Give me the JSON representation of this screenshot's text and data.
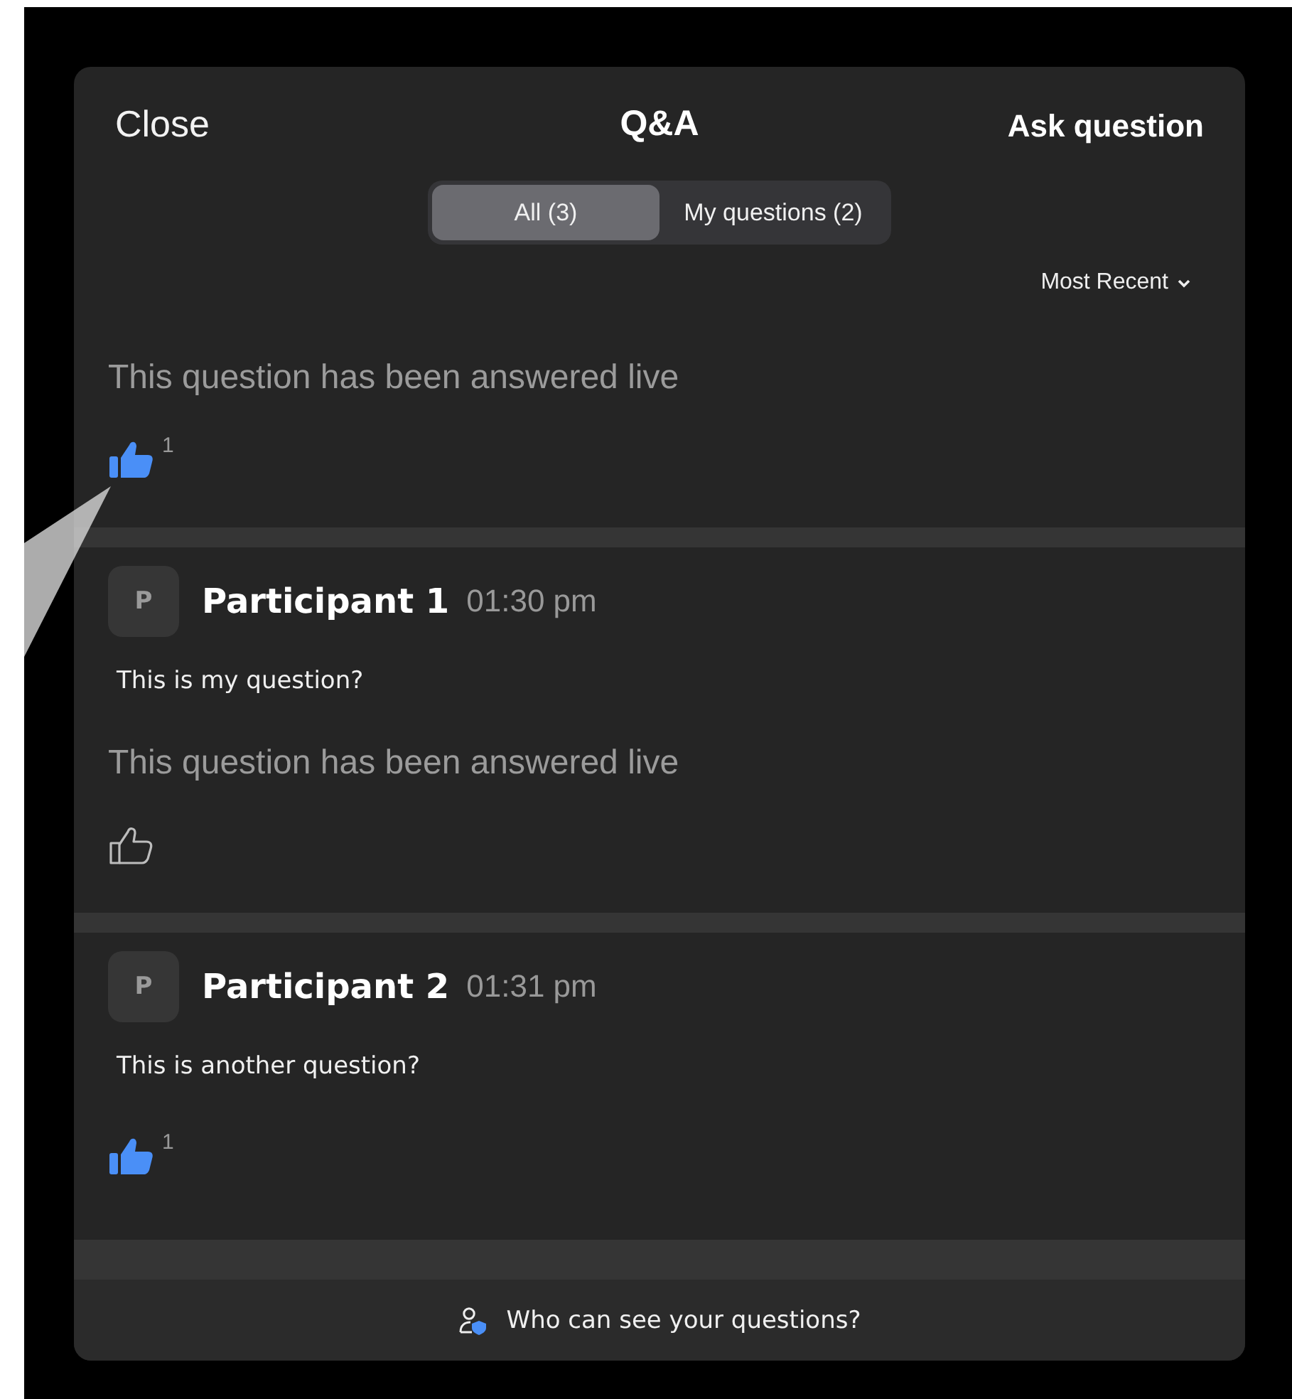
{
  "header": {
    "close": "Close",
    "title": "Q&A",
    "action": "Ask question"
  },
  "filters": [
    {
      "label": "All (3)",
      "selected": true
    },
    {
      "label": "My questions (2)",
      "selected": false
    }
  ],
  "sort": {
    "label": "Most Recent"
  },
  "questions": [
    {
      "answered_note": "This question has been answered live",
      "liked": true,
      "likes": "1"
    },
    {
      "avatar": "P",
      "author": "Participant 1",
      "time": "01:30 pm",
      "text": "This is my question?",
      "answered_note": "This question has been answered live",
      "liked": false
    },
    {
      "avatar": "P",
      "author": "Participant 2",
      "time": "01:31 pm",
      "text": "This is another question?",
      "liked": true,
      "likes": "1"
    }
  ],
  "footer": {
    "label": "Who can see your questions?"
  }
}
